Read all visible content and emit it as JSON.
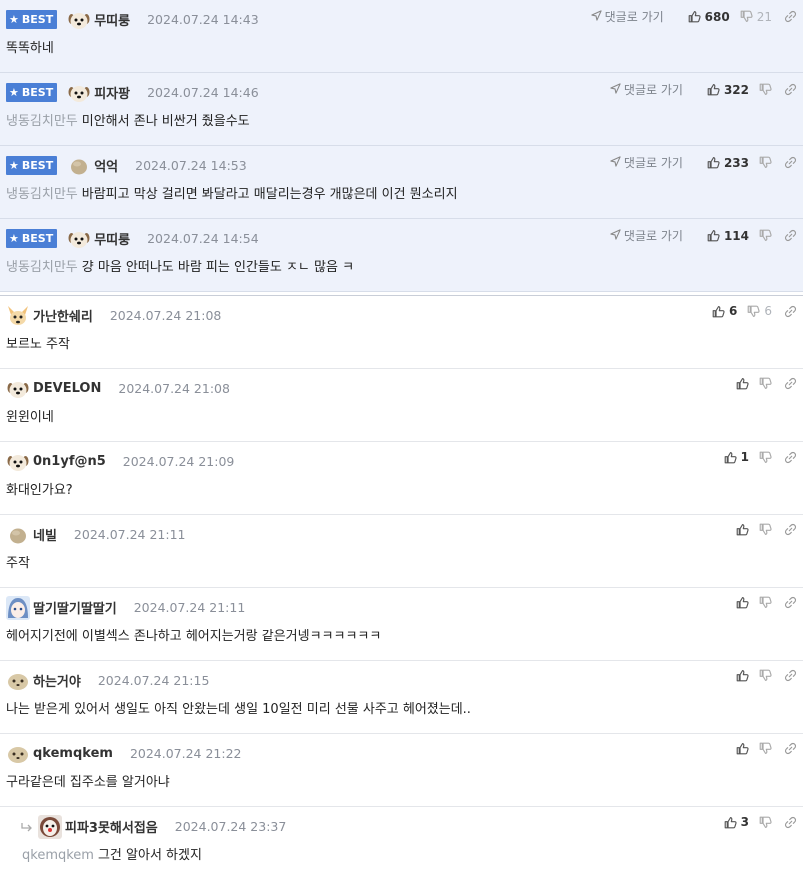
{
  "best_label": "BEST",
  "goto_label": "댓글로 가기",
  "best_comments": [
    {
      "nick": "무띠룽",
      "date": "2024.07.24 14:43",
      "reply_to": "",
      "text": "똑똑하네",
      "up": "680",
      "down": "21",
      "avatar": "dog-face-icon"
    },
    {
      "nick": "피자팡",
      "date": "2024.07.24 14:46",
      "reply_to": "냉동김치만두",
      "text": "미안해서 존나 비싼거 줬을수도",
      "up": "322",
      "down": "",
      "avatar": "dog-face-icon"
    },
    {
      "nick": "억억",
      "date": "2024.07.24 14:53",
      "reply_to": "냉동김치만두",
      "text": "바람피고 막상 걸리면 봐달라고 매달리는경우 개많은데 이건 뭔소리지",
      "up": "233",
      "down": "",
      "avatar": "blob-icon"
    },
    {
      "nick": "무띠룽",
      "date": "2024.07.24 14:54",
      "reply_to": "냉동김치만두",
      "text": "걍 마음 안떠나도 바람 피는 인간들도 ㅈㄴ 많음 ㅋ",
      "up": "114",
      "down": "",
      "avatar": "dog-face-icon"
    }
  ],
  "comments": [
    {
      "nick": "가난한쉐리",
      "date": "2024.07.24 21:08",
      "reply_to": "",
      "text": "보르노 주작",
      "up": "6",
      "down": "6",
      "avatar": "fox-icon"
    },
    {
      "nick": "DEVELON",
      "date": "2024.07.24 21:08",
      "reply_to": "",
      "text": "윈윈이네",
      "up": "",
      "down": "",
      "avatar": "dog-face-icon"
    },
    {
      "nick": "0n1yf@n5",
      "date": "2024.07.24 21:09",
      "reply_to": "",
      "text": "화대인가요?",
      "up": "1",
      "down": "",
      "avatar": "dog-face-icon"
    },
    {
      "nick": "네빌",
      "date": "2024.07.24 21:11",
      "reply_to": "",
      "text": "주작",
      "up": "",
      "down": "",
      "avatar": "blob-icon"
    },
    {
      "nick": "딸기딸기딸딸기",
      "date": "2024.07.24 21:11",
      "reply_to": "",
      "text": "헤어지기전에 이별섹스 존나하고 헤어지는거랑 같은거넹ㅋㅋㅋㅋㅋㅋ",
      "up": "",
      "down": "",
      "avatar": "anime-girl-icon"
    },
    {
      "nick": "하는거야",
      "date": "2024.07.24 21:15",
      "reply_to": "",
      "text": "나는 받은게 있어서 생일도 아직 안왔는데 생일 10일전 미리 선물 사주고 헤어졌는데..",
      "up": "",
      "down": "",
      "avatar": "blob-face-icon"
    },
    {
      "nick": "qkemqkem",
      "date": "2024.07.24 21:22",
      "reply_to": "",
      "text": "구라같은데 집주소를 알거아냐",
      "up": "",
      "down": "",
      "avatar": "blob-face-icon"
    }
  ],
  "reply": {
    "nick": "피파3못해서접음",
    "date": "2024.07.24 23:37",
    "reply_to": "qkemqkem",
    "text": "그건 알아서 하겠지",
    "up": "3",
    "down": "",
    "avatar": "clown-icon"
  },
  "colors": {
    "best_bg": "#eef2fb",
    "badge": "#4a7fd6",
    "divider": "#e4e6ea"
  }
}
